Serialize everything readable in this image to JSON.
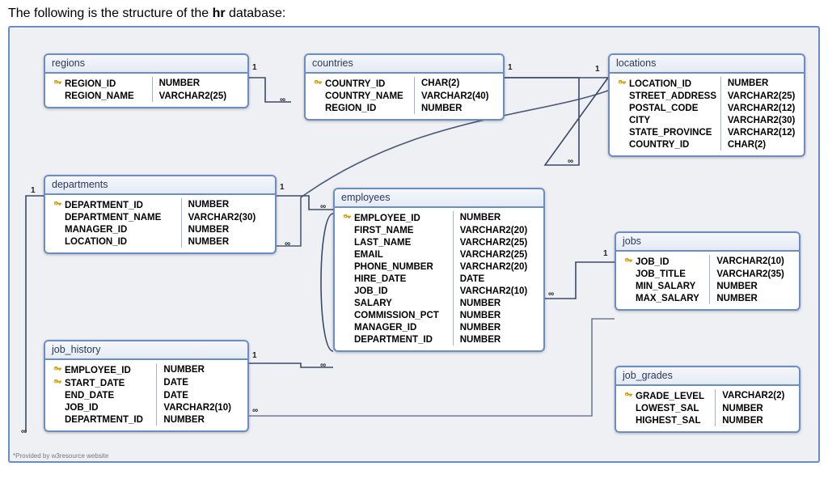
{
  "heading_prefix": "The following is the structure of the ",
  "heading_bold": "hr",
  "heading_suffix": " database:",
  "footnote": "*Provided by w3resource website",
  "entities": {
    "regions": {
      "title": "regions",
      "columns": [
        {
          "pk": true,
          "name": "REGION_ID",
          "type": "NUMBER"
        },
        {
          "pk": false,
          "name": "REGION_NAME",
          "type": "VARCHAR2(25)"
        }
      ]
    },
    "countries": {
      "title": "countries",
      "columns": [
        {
          "pk": true,
          "name": "COUNTRY_ID",
          "type": "CHAR(2)"
        },
        {
          "pk": false,
          "name": "COUNTRY_NAME",
          "type": "VARCHAR2(40)"
        },
        {
          "pk": false,
          "name": "REGION_ID",
          "type": "NUMBER"
        }
      ]
    },
    "locations": {
      "title": "locations",
      "columns": [
        {
          "pk": true,
          "name": "LOCATION_ID",
          "type": "NUMBER"
        },
        {
          "pk": false,
          "name": "STREET_ADDRESS",
          "type": "VARCHAR2(25)"
        },
        {
          "pk": false,
          "name": "POSTAL_CODE",
          "type": "VARCHAR2(12)"
        },
        {
          "pk": false,
          "name": "CITY",
          "type": "VARCHAR2(30)"
        },
        {
          "pk": false,
          "name": "STATE_PROVINCE",
          "type": "VARCHAR2(12)"
        },
        {
          "pk": false,
          "name": "COUNTRY_ID",
          "type": "CHAR(2)"
        }
      ]
    },
    "departments": {
      "title": "departments",
      "columns": [
        {
          "pk": true,
          "name": "DEPARTMENT_ID",
          "type": "NUMBER"
        },
        {
          "pk": false,
          "name": "DEPARTMENT_NAME",
          "type": "VARCHAR2(30)"
        },
        {
          "pk": false,
          "name": "MANAGER_ID",
          "type": "NUMBER"
        },
        {
          "pk": false,
          "name": "LOCATION_ID",
          "type": "NUMBER"
        }
      ]
    },
    "employees": {
      "title": "employees",
      "columns": [
        {
          "pk": true,
          "name": "EMPLOYEE_ID",
          "type": "NUMBER"
        },
        {
          "pk": false,
          "name": "FIRST_NAME",
          "type": "VARCHAR2(20)"
        },
        {
          "pk": false,
          "name": "LAST_NAME",
          "type": "VARCHAR2(25)"
        },
        {
          "pk": false,
          "name": "EMAIL",
          "type": "VARCHAR2(25)"
        },
        {
          "pk": false,
          "name": "PHONE_NUMBER",
          "type": "VARCHAR2(20)"
        },
        {
          "pk": false,
          "name": "HIRE_DATE",
          "type": "DATE"
        },
        {
          "pk": false,
          "name": "JOB_ID",
          "type": "VARCHAR2(10)"
        },
        {
          "pk": false,
          "name": "SALARY",
          "type": "NUMBER"
        },
        {
          "pk": false,
          "name": "COMMISSION_PCT",
          "type": "NUMBER"
        },
        {
          "pk": false,
          "name": "MANAGER_ID",
          "type": "NUMBER"
        },
        {
          "pk": false,
          "name": "DEPARTMENT_ID",
          "type": "NUMBER"
        }
      ]
    },
    "jobs": {
      "title": "jobs",
      "columns": [
        {
          "pk": true,
          "name": "JOB_ID",
          "type": "VARCHAR2(10)"
        },
        {
          "pk": false,
          "name": "JOB_TITLE",
          "type": "VARCHAR2(35)"
        },
        {
          "pk": false,
          "name": "MIN_SALARY",
          "type": "NUMBER"
        },
        {
          "pk": false,
          "name": "MAX_SALARY",
          "type": "NUMBER"
        }
      ]
    },
    "job_history": {
      "title": "job_history",
      "columns": [
        {
          "pk": true,
          "name": "EMPLOYEE_ID",
          "type": "NUMBER"
        },
        {
          "pk": true,
          "name": "START_DATE",
          "type": "DATE"
        },
        {
          "pk": false,
          "name": "END_DATE",
          "type": "DATE"
        },
        {
          "pk": false,
          "name": "JOB_ID",
          "type": "VARCHAR2(10)"
        },
        {
          "pk": false,
          "name": "DEPARTMENT_ID",
          "type": "NUMBER"
        }
      ]
    },
    "job_grades": {
      "title": "job_grades",
      "columns": [
        {
          "pk": true,
          "name": "GRADE_LEVEL",
          "type": "VARCHAR2(2)"
        },
        {
          "pk": false,
          "name": "LOWEST_SAL",
          "type": "NUMBER"
        },
        {
          "pk": false,
          "name": "HIGHEST_SAL",
          "type": "NUMBER"
        }
      ]
    }
  },
  "cardinality": {
    "one": "1",
    "many": "∞"
  }
}
